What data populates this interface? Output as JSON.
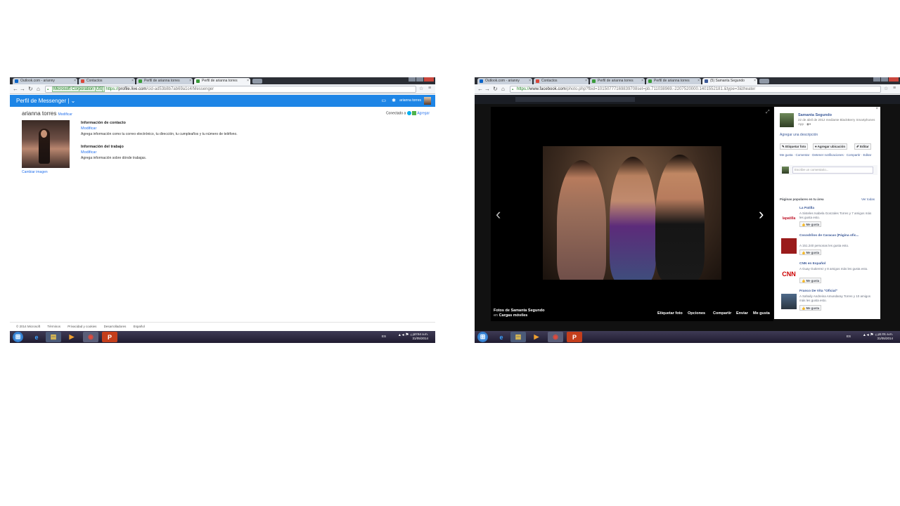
{
  "left": {
    "tabs": [
      "Outlook.com - arianny",
      "Contactos",
      "Perfil de arianna torres",
      "Perfil de arianna torres"
    ],
    "url": {
      "ev": "Microsoft Corporation [US]",
      "scheme": "https://",
      "host": "profile.live.com",
      "path": "/cid-ad53b8b7ab69a1c4/Messenger"
    },
    "app_title": "Perfil de Messenger",
    "user_name": "arianna torres",
    "profile_name": "arianna torres",
    "modificar": "Modificar",
    "change_image": "Cambiar imagen",
    "contact": {
      "heading": "Información de contacto",
      "link": "Modificar",
      "text": "Agrega información como tu correo electrónico, tu dirección, tu cumpleaños y tu número de teléfono."
    },
    "work": {
      "heading": "Información del trabajo",
      "link": "Modificar",
      "text": "Agrega información sobre dónde trabajas."
    },
    "connected": "Conectado a",
    "add": "Agregar",
    "footer": [
      "© 2014 Microsoft",
      "Términos",
      "Privacidad y cookies",
      "Desarrolladores",
      "Español"
    ],
    "tray": {
      "lang": "ES",
      "time": "10:54 a.m.",
      "date": "31/05/2014"
    }
  },
  "right": {
    "tabs": [
      "Outlook.com - arianny",
      "Contactos",
      "Perfil de arianna torres",
      "Perfil de arianna torres",
      "(5) Samanta Segundo"
    ],
    "url": {
      "scheme": "https://",
      "host": "www.facebook.com",
      "path": "/photo.php?fbid=10150777169839708set=pb.711038969.-2207520000.1401552181.&type=3&theater"
    },
    "caption": {
      "title": "Fotos de Samanta Segundo",
      "prefix": "en",
      "album": "Cargas móviles"
    },
    "actions": [
      "Etiquetar foto",
      "Opciones",
      "Compartir",
      "Enviar",
      "Me gusta"
    ],
    "poster": {
      "name": "Samanta Segundo",
      "meta": "22 de abril de 2012 mediante BlackBerry Smartphones App ·"
    },
    "add_desc": "Agregar una descripción",
    "buttons": [
      "Etiquetar foto",
      "Agregar ubicación",
      "Editar"
    ],
    "links": "Me gusta · Comentar · Detener notificaciones · Compartir · Editar",
    "comment_placeholder": "Escribe un comentario...",
    "popular": {
      "title": "Páginas populares en tu área",
      "see_all": "Ver todas"
    },
    "pages": [
      {
        "name": "La Patilla",
        "desc": "A Sisteles Isabela Gonzales Torres y 7 amigos más les gusta esto.",
        "btn": "Me gusta",
        "logo": "lapatilla"
      },
      {
        "name": "Cocodrilos de Caracas (Página ofic...",
        "desc": "A 151.240 personas les gusta esto.",
        "btn": "Me gusta",
        "logo": ""
      },
      {
        "name": "CNN en Español",
        "desc": "A Guay Gutierrez y 8 amigos más les gusta esto.",
        "btn": "Me gusta",
        "logo": "CNN"
      },
      {
        "name": "Franco De Vita \"Oficial\"",
        "desc": "A Sahaily Andreina Amundaray Torres y 10 amigos más les gusta esto.",
        "btn": "Me gusta",
        "logo": ""
      }
    ],
    "tray": {
      "lang": "ES",
      "time": "11:01 a.m.",
      "date": "31/05/2014"
    }
  }
}
